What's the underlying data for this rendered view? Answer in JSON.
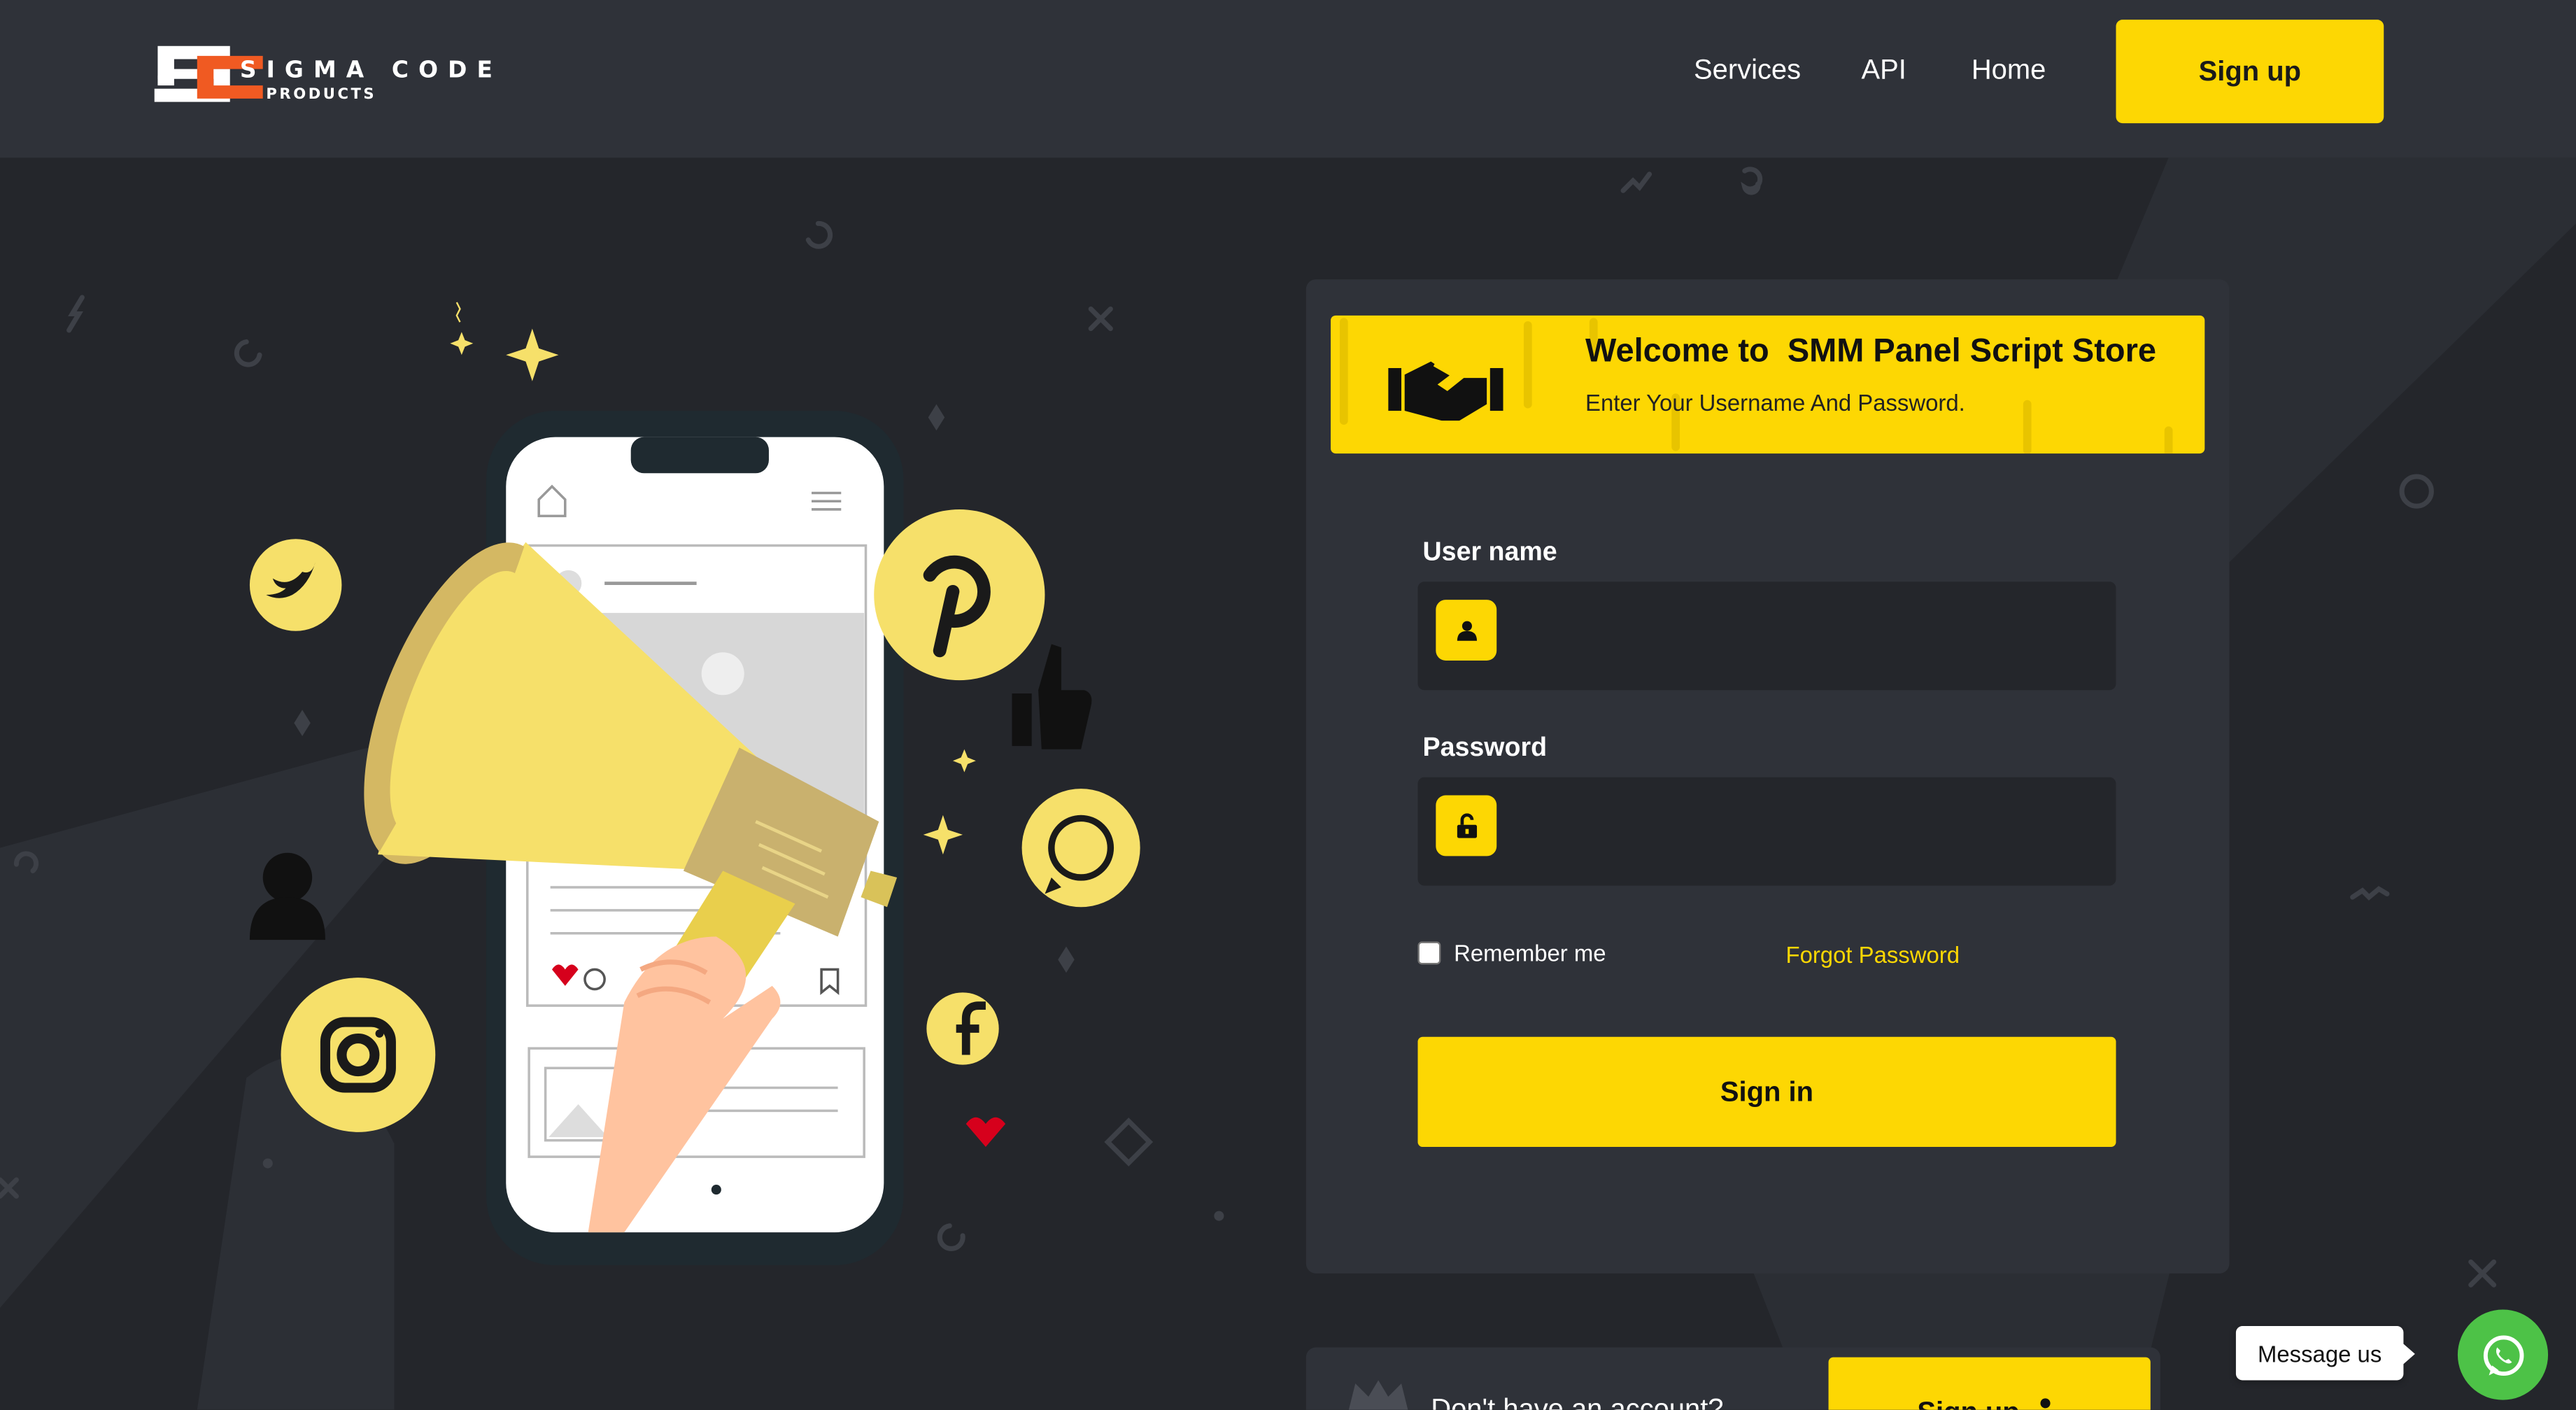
{
  "brand": {
    "main": "SIGMA CODE",
    "sub": "PRODUCTS"
  },
  "nav": {
    "links": [
      "Services",
      "API",
      "Home"
    ],
    "signup_label": "Sign up"
  },
  "login": {
    "welcome_title": "Welcome to  SMM Panel Script Store",
    "welcome_subtitle": "Enter Your Username And Password.",
    "username_label": "User name",
    "username_value": "",
    "password_label": "Password",
    "password_value": "",
    "remember_label": "Remember me",
    "remember_checked": false,
    "forgot_label": "Forgot Password",
    "signin_label": "Sign in"
  },
  "signup_prompt": {
    "text": "Don't have an account?",
    "button_label": "Sign up"
  },
  "chat": {
    "bubble_label": "Message us"
  },
  "colors": {
    "accent": "#fdd703",
    "background": "#24262b",
    "panel": "#2f3239",
    "whatsapp": "#4dc247"
  }
}
